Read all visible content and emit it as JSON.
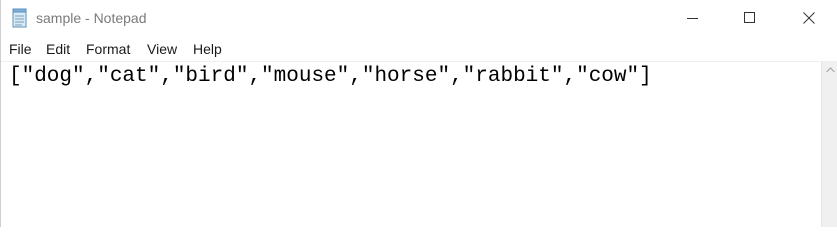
{
  "window": {
    "title": "sample - Notepad",
    "icon": "notepad-icon"
  },
  "title_buttons": {
    "minimize_icon": "minimize-icon",
    "maximize_icon": "maximize-icon",
    "close_icon": "close-icon"
  },
  "menu": {
    "items": [
      "File",
      "Edit",
      "Format",
      "View",
      "Help"
    ]
  },
  "editor": {
    "content": "[\"dog\",\"cat\",\"bird\",\"mouse\",\"horse\",\"rabbit\",\"cow\"]"
  },
  "scrollbar": {
    "up_icon": "chevron-up-icon"
  },
  "colors": {
    "title_text": "#7a7a7a",
    "text": "#000000",
    "scrollbar_bg": "#f0f0f0"
  }
}
